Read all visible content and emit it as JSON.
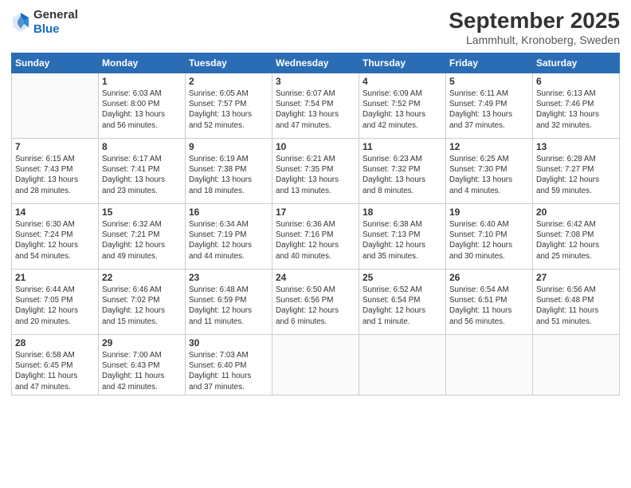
{
  "header": {
    "logo": {
      "general": "General",
      "blue": "Blue"
    },
    "title": "September 2025",
    "location": "Lammhult, Kronoberg, Sweden"
  },
  "weekdays": [
    "Sunday",
    "Monday",
    "Tuesday",
    "Wednesday",
    "Thursday",
    "Friday",
    "Saturday"
  ],
  "weeks": [
    [
      {
        "day": "",
        "info": ""
      },
      {
        "day": "1",
        "info": "Sunrise: 6:03 AM\nSunset: 8:00 PM\nDaylight: 13 hours\nand 56 minutes."
      },
      {
        "day": "2",
        "info": "Sunrise: 6:05 AM\nSunset: 7:57 PM\nDaylight: 13 hours\nand 52 minutes."
      },
      {
        "day": "3",
        "info": "Sunrise: 6:07 AM\nSunset: 7:54 PM\nDaylight: 13 hours\nand 47 minutes."
      },
      {
        "day": "4",
        "info": "Sunrise: 6:09 AM\nSunset: 7:52 PM\nDaylight: 13 hours\nand 42 minutes."
      },
      {
        "day": "5",
        "info": "Sunrise: 6:11 AM\nSunset: 7:49 PM\nDaylight: 13 hours\nand 37 minutes."
      },
      {
        "day": "6",
        "info": "Sunrise: 6:13 AM\nSunset: 7:46 PM\nDaylight: 13 hours\nand 32 minutes."
      }
    ],
    [
      {
        "day": "7",
        "info": "Sunrise: 6:15 AM\nSunset: 7:43 PM\nDaylight: 13 hours\nand 28 minutes."
      },
      {
        "day": "8",
        "info": "Sunrise: 6:17 AM\nSunset: 7:41 PM\nDaylight: 13 hours\nand 23 minutes."
      },
      {
        "day": "9",
        "info": "Sunrise: 6:19 AM\nSunset: 7:38 PM\nDaylight: 13 hours\nand 18 minutes."
      },
      {
        "day": "10",
        "info": "Sunrise: 6:21 AM\nSunset: 7:35 PM\nDaylight: 13 hours\nand 13 minutes."
      },
      {
        "day": "11",
        "info": "Sunrise: 6:23 AM\nSunset: 7:32 PM\nDaylight: 13 hours\nand 8 minutes."
      },
      {
        "day": "12",
        "info": "Sunrise: 6:25 AM\nSunset: 7:30 PM\nDaylight: 13 hours\nand 4 minutes."
      },
      {
        "day": "13",
        "info": "Sunrise: 6:28 AM\nSunset: 7:27 PM\nDaylight: 12 hours\nand 59 minutes."
      }
    ],
    [
      {
        "day": "14",
        "info": "Sunrise: 6:30 AM\nSunset: 7:24 PM\nDaylight: 12 hours\nand 54 minutes."
      },
      {
        "day": "15",
        "info": "Sunrise: 6:32 AM\nSunset: 7:21 PM\nDaylight: 12 hours\nand 49 minutes."
      },
      {
        "day": "16",
        "info": "Sunrise: 6:34 AM\nSunset: 7:19 PM\nDaylight: 12 hours\nand 44 minutes."
      },
      {
        "day": "17",
        "info": "Sunrise: 6:36 AM\nSunset: 7:16 PM\nDaylight: 12 hours\nand 40 minutes."
      },
      {
        "day": "18",
        "info": "Sunrise: 6:38 AM\nSunset: 7:13 PM\nDaylight: 12 hours\nand 35 minutes."
      },
      {
        "day": "19",
        "info": "Sunrise: 6:40 AM\nSunset: 7:10 PM\nDaylight: 12 hours\nand 30 minutes."
      },
      {
        "day": "20",
        "info": "Sunrise: 6:42 AM\nSunset: 7:08 PM\nDaylight: 12 hours\nand 25 minutes."
      }
    ],
    [
      {
        "day": "21",
        "info": "Sunrise: 6:44 AM\nSunset: 7:05 PM\nDaylight: 12 hours\nand 20 minutes."
      },
      {
        "day": "22",
        "info": "Sunrise: 6:46 AM\nSunset: 7:02 PM\nDaylight: 12 hours\nand 15 minutes."
      },
      {
        "day": "23",
        "info": "Sunrise: 6:48 AM\nSunset: 6:59 PM\nDaylight: 12 hours\nand 11 minutes."
      },
      {
        "day": "24",
        "info": "Sunrise: 6:50 AM\nSunset: 6:56 PM\nDaylight: 12 hours\nand 6 minutes."
      },
      {
        "day": "25",
        "info": "Sunrise: 6:52 AM\nSunset: 6:54 PM\nDaylight: 12 hours\nand 1 minute."
      },
      {
        "day": "26",
        "info": "Sunrise: 6:54 AM\nSunset: 6:51 PM\nDaylight: 11 hours\nand 56 minutes."
      },
      {
        "day": "27",
        "info": "Sunrise: 6:56 AM\nSunset: 6:48 PM\nDaylight: 11 hours\nand 51 minutes."
      }
    ],
    [
      {
        "day": "28",
        "info": "Sunrise: 6:58 AM\nSunset: 6:45 PM\nDaylight: 11 hours\nand 47 minutes."
      },
      {
        "day": "29",
        "info": "Sunrise: 7:00 AM\nSunset: 6:43 PM\nDaylight: 11 hours\nand 42 minutes."
      },
      {
        "day": "30",
        "info": "Sunrise: 7:03 AM\nSunset: 6:40 PM\nDaylight: 11 hours\nand 37 minutes."
      },
      {
        "day": "",
        "info": ""
      },
      {
        "day": "",
        "info": ""
      },
      {
        "day": "",
        "info": ""
      },
      {
        "day": "",
        "info": ""
      }
    ]
  ]
}
